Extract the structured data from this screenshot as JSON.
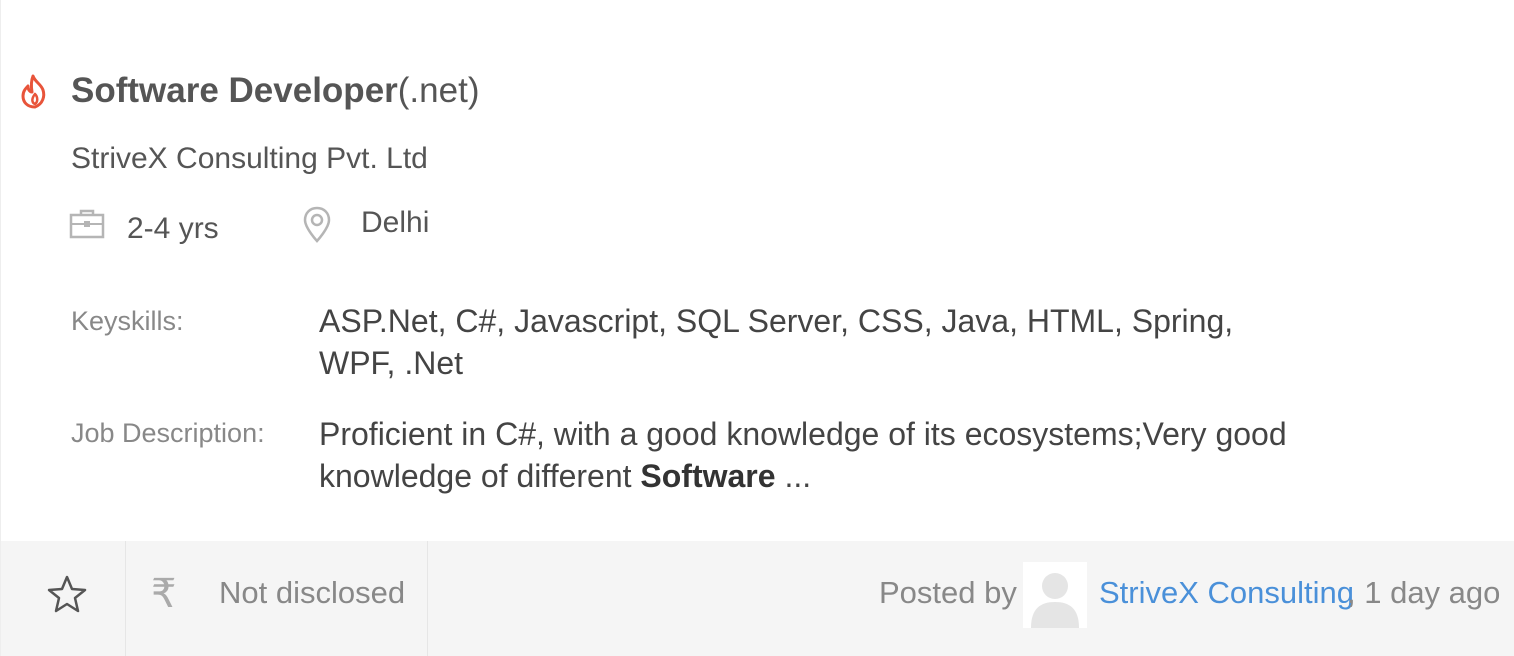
{
  "job": {
    "title_main": "Software Developer",
    "title_suffix": "(.net)",
    "company": "StriveX Consulting Pvt. Ltd",
    "experience": "2-4 yrs",
    "location": "Delhi",
    "keyskills_label": "Keyskills:",
    "keyskills": "ASP.Net, C#, Javascript, SQL Server, CSS, Java, HTML, Spring, WPF, .Net",
    "description_label": "Job Description:",
    "description_text": "Proficient in C#, with a good knowledge of its ecosystems;Very good knowledge of different ",
    "description_highlight": "Software",
    "description_ellipsis": " ..."
  },
  "footer": {
    "salary": "Not disclosed",
    "posted_by_label": "Posted by",
    "poster_name": "StriveX Consulting",
    "posted_time": ", 1 day ago"
  },
  "icons": {
    "hot": "flame-icon",
    "experience": "briefcase-icon",
    "location": "map-pin-icon",
    "save": "star-icon",
    "salary": "rupee-icon",
    "avatar": "user-avatar"
  },
  "colors": {
    "hot_icon": "#e8543a",
    "link": "#4a90d9",
    "footer_bg": "#f5f5f5",
    "muted_text": "#888888"
  }
}
